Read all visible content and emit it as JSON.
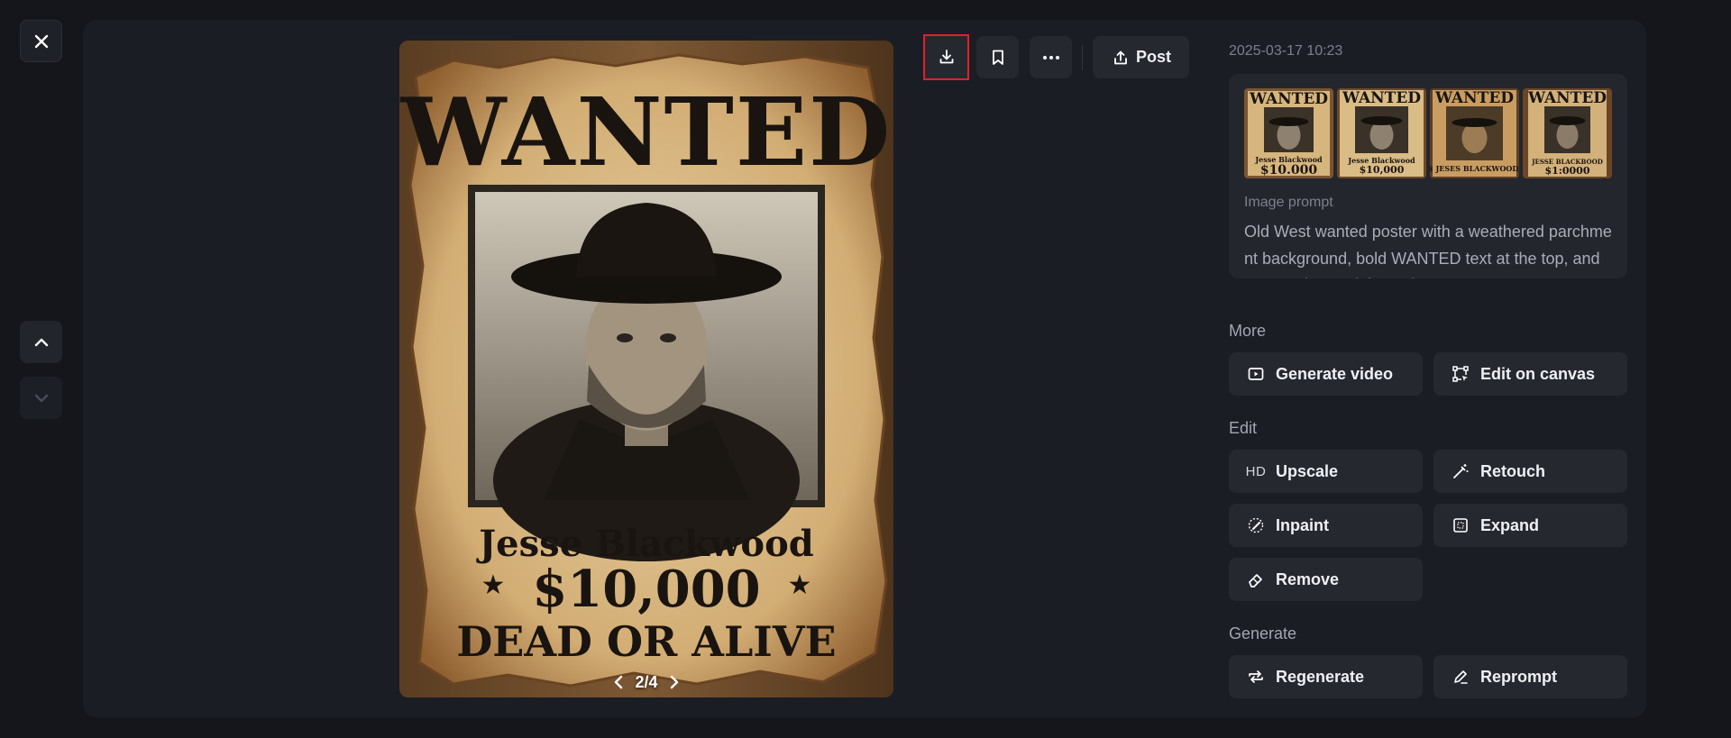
{
  "pager": {
    "text": "2/4"
  },
  "poster": {
    "headline": "WANTED",
    "name": "Jesse Blackwood",
    "reward": "$10,000",
    "status": "DEAD OR ALIVE"
  },
  "toolbar": {
    "post_label": "Post"
  },
  "side": {
    "date": "2025-03-17 10:23",
    "thumbs": [
      {
        "headline": "WANTED",
        "caption": "Jesse Blackwood",
        "reward": "$10.000"
      },
      {
        "headline": "WANTED",
        "caption": "Jesse Blackwood",
        "reward": "$10,000"
      },
      {
        "headline": "WANTED",
        "caption": "$ JESES BLACKWOOD,",
        "reward": ""
      },
      {
        "headline": "WANTED",
        "caption": "JESSE BLACKBOOD",
        "reward": "$1:0000"
      }
    ],
    "prompt_label": "Image prompt",
    "prompt_text": "Old West wanted poster with a weathered parchment background, bold WANTED text at the top, and a rugged portrait in sepia tones. Feat",
    "sections": {
      "more": "More",
      "edit": "Edit",
      "generate": "Generate"
    },
    "actions": {
      "generate_video": "Generate video",
      "edit_on_canvas": "Edit on canvas",
      "hd_badge": "HD",
      "upscale": "Upscale",
      "retouch": "Retouch",
      "inpaint": "Inpaint",
      "expand": "Expand",
      "remove": "Remove",
      "regenerate": "Regenerate",
      "reprompt": "Reprompt"
    }
  }
}
